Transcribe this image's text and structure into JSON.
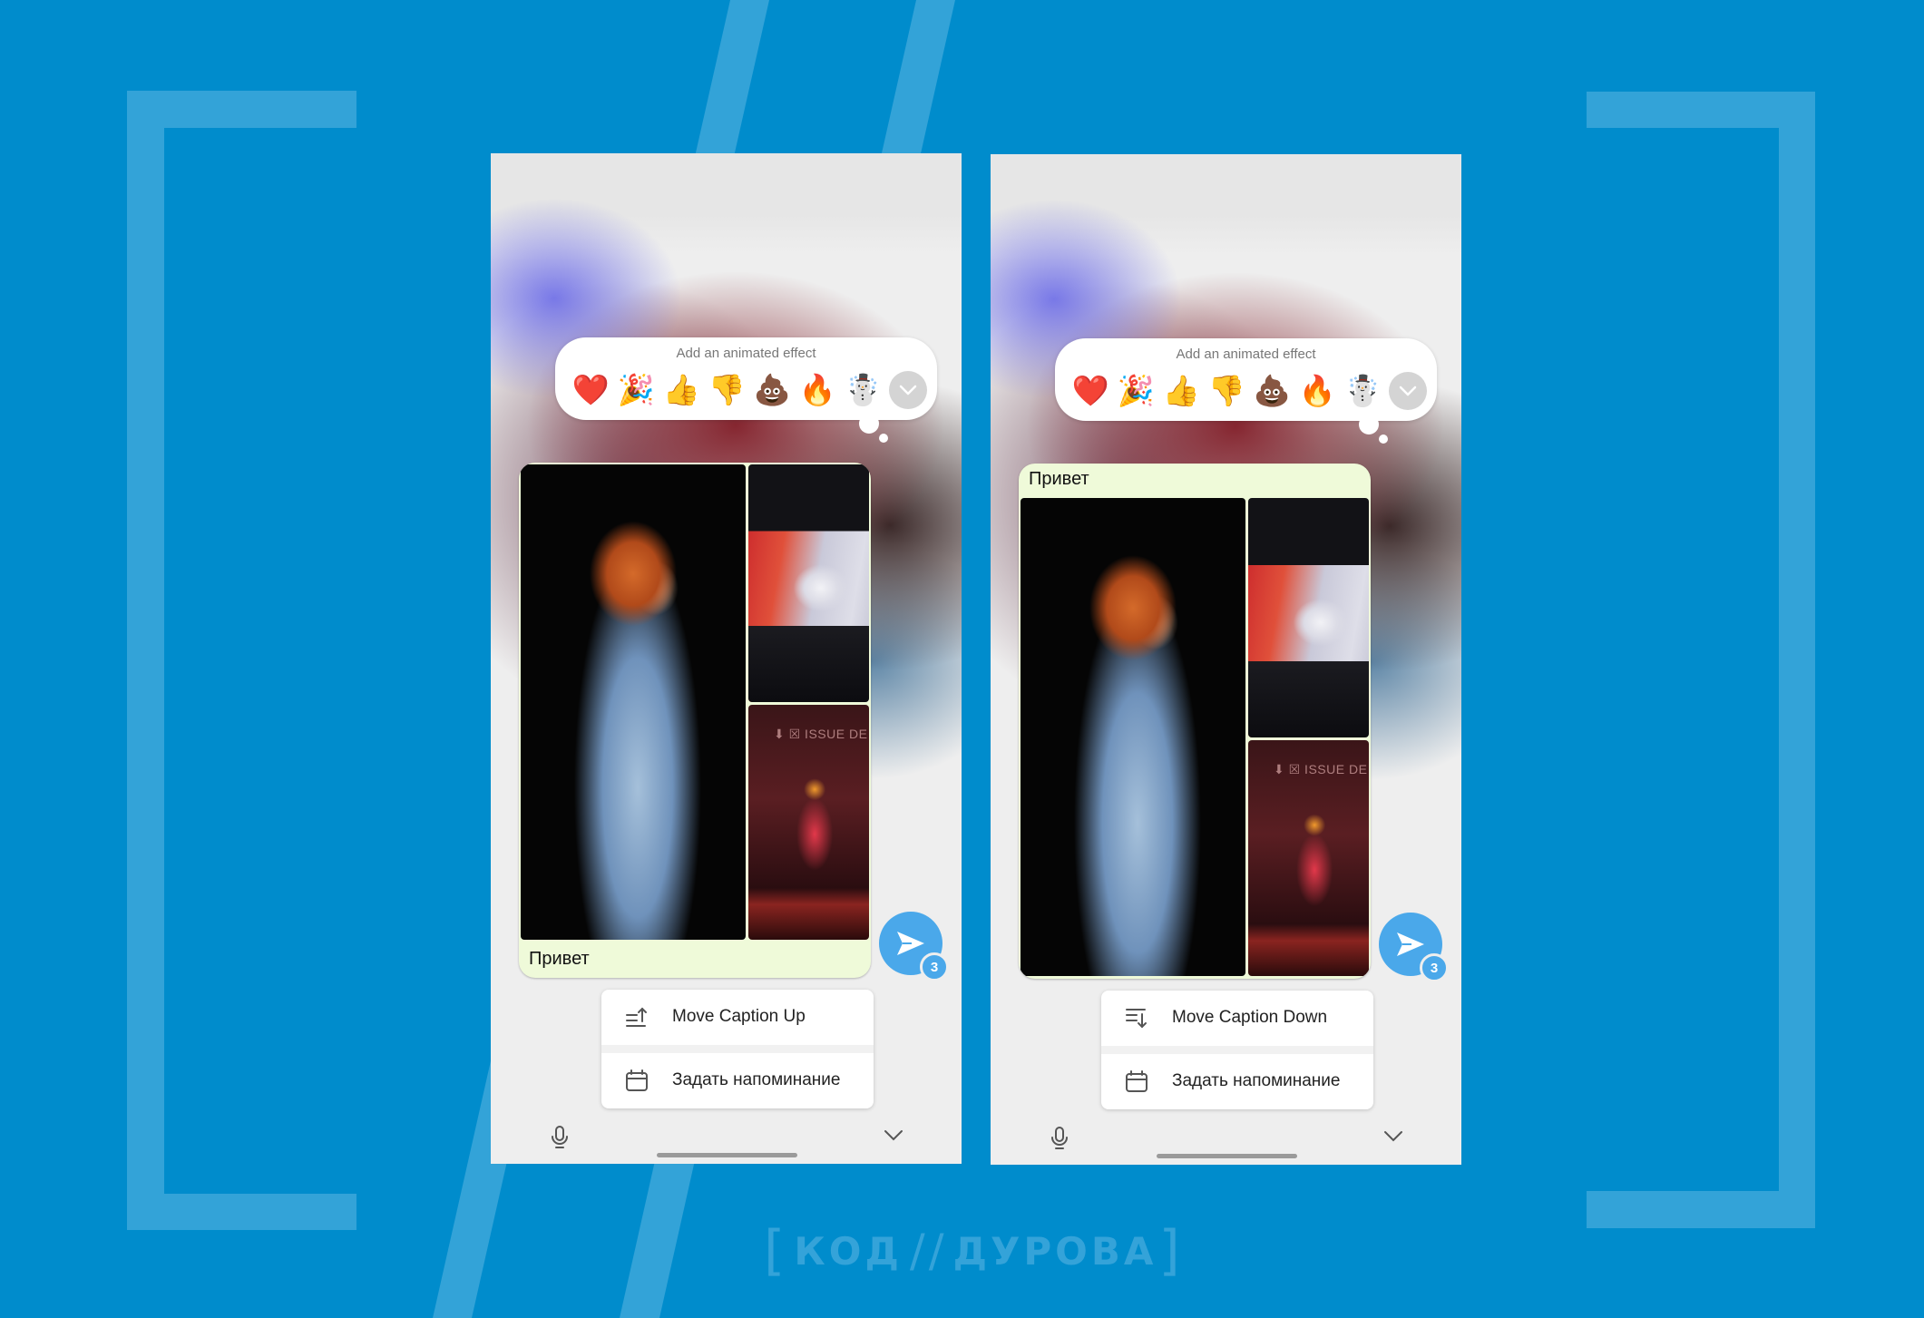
{
  "colors": {
    "background": "#008ccc",
    "decor": "#33a3d8",
    "accent": "#4aa8ea",
    "bubble": "#effad9"
  },
  "phones": [
    {
      "id": "before",
      "effect_popup": {
        "title": "Add an animated effect",
        "emojis": [
          "❤️",
          "🎉",
          "👍",
          "👎",
          "💩",
          "🔥",
          "☃️"
        ],
        "expand_icon": "chevron-down-icon"
      },
      "message": {
        "caption": "Привет",
        "caption_position": "below",
        "photo_count": 3,
        "stage_sign": "⬇ ☒ ISSUE DE SECO"
      },
      "send": {
        "icon": "send-icon",
        "badge": "3"
      },
      "menu": [
        {
          "icon": "move-caption-up-icon",
          "label": "Move Caption Up"
        },
        {
          "icon": "calendar-icon",
          "label": "Задать напоминание"
        }
      ],
      "bottom": {
        "left_icon": "microphone-icon",
        "right_icon": "chevron-down-icon"
      }
    },
    {
      "id": "after",
      "effect_popup": {
        "title": "Add an animated effect",
        "emojis": [
          "❤️",
          "🎉",
          "👍",
          "👎",
          "💩",
          "🔥",
          "☃️"
        ],
        "expand_icon": "chevron-down-icon"
      },
      "message": {
        "caption": "Привет",
        "caption_position": "above",
        "photo_count": 3,
        "stage_sign": "⬇ ☒ ISSUE DE SECO"
      },
      "send": {
        "icon": "send-icon",
        "badge": "3"
      },
      "menu": [
        {
          "icon": "move-caption-down-icon",
          "label": "Move Caption Down"
        },
        {
          "icon": "calendar-icon",
          "label": "Задать напоминание"
        }
      ],
      "bottom": {
        "left_icon": "microphone-icon",
        "right_icon": "chevron-down-icon"
      }
    }
  ],
  "watermark": {
    "open": "[",
    "word1": "КОД",
    "sep": "//",
    "word2": "ДУРОВА",
    "close": "]"
  }
}
